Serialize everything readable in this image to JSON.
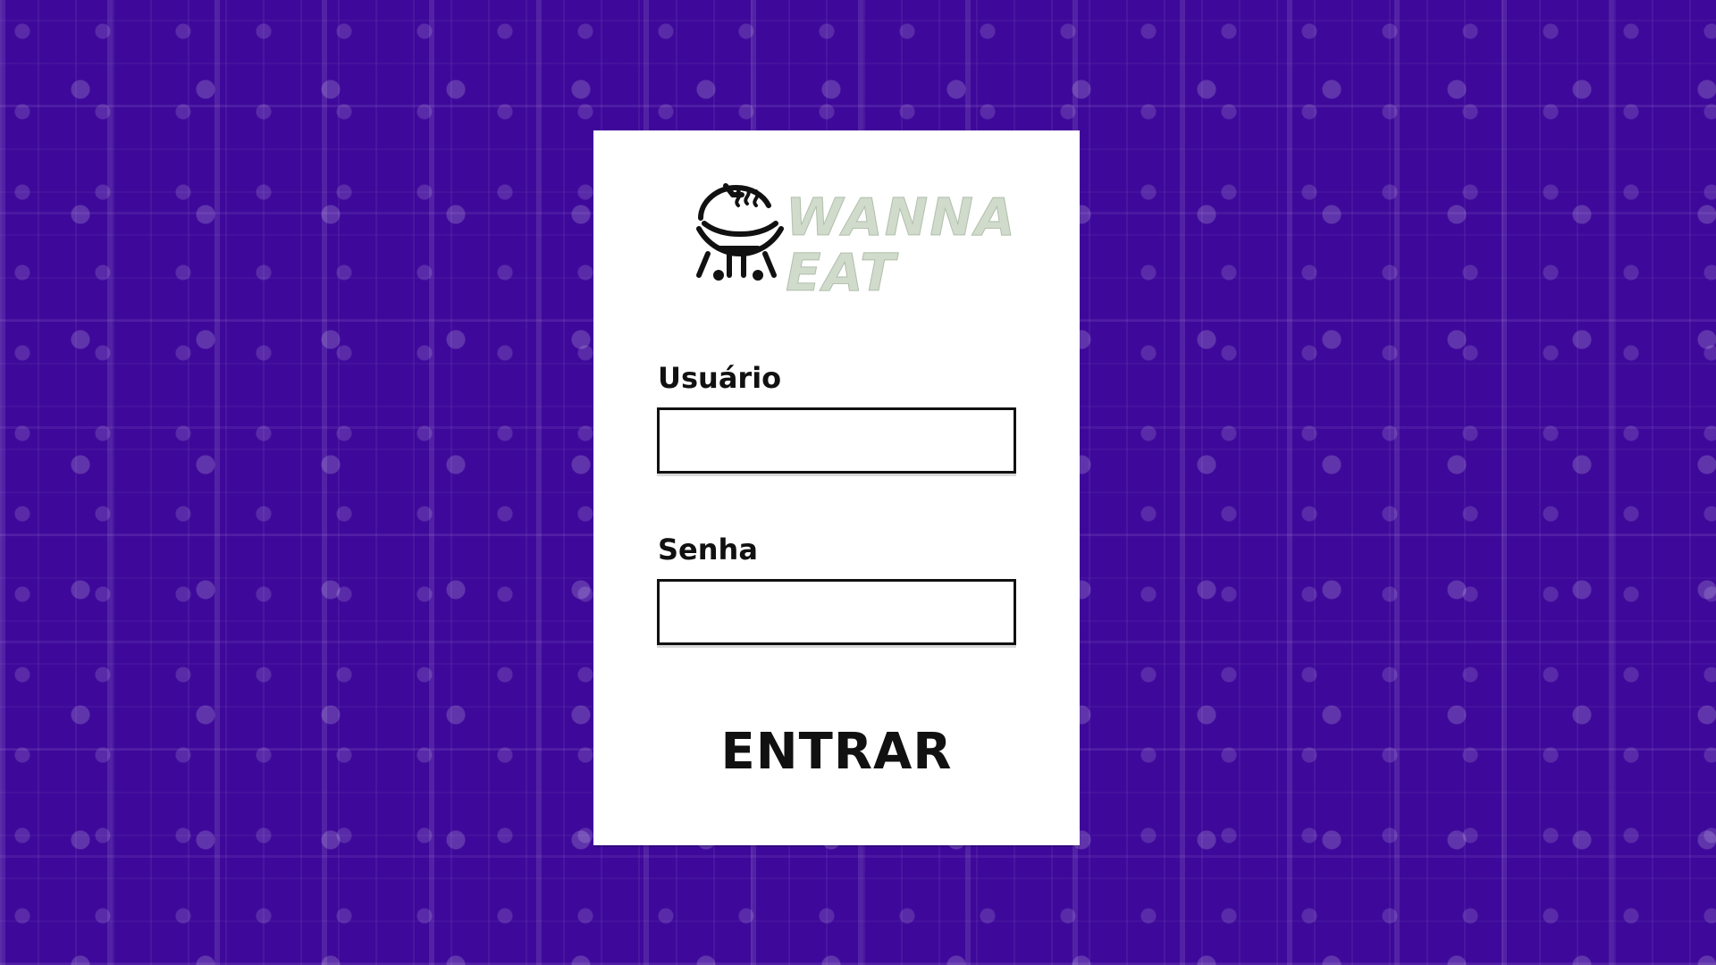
{
  "background": {
    "pattern": "bbq-icon-pattern",
    "primary_color": "#3b0b8f",
    "icon_color": "#ffffff"
  },
  "login": {
    "brand": {
      "icon": "grill-icon",
      "text": "WANNA\nEAT"
    },
    "username": {
      "label": "Usuário",
      "value": "",
      "placeholder": ""
    },
    "password": {
      "label": "Senha",
      "value": "",
      "placeholder": ""
    },
    "submit_label": "ENTRAR"
  }
}
